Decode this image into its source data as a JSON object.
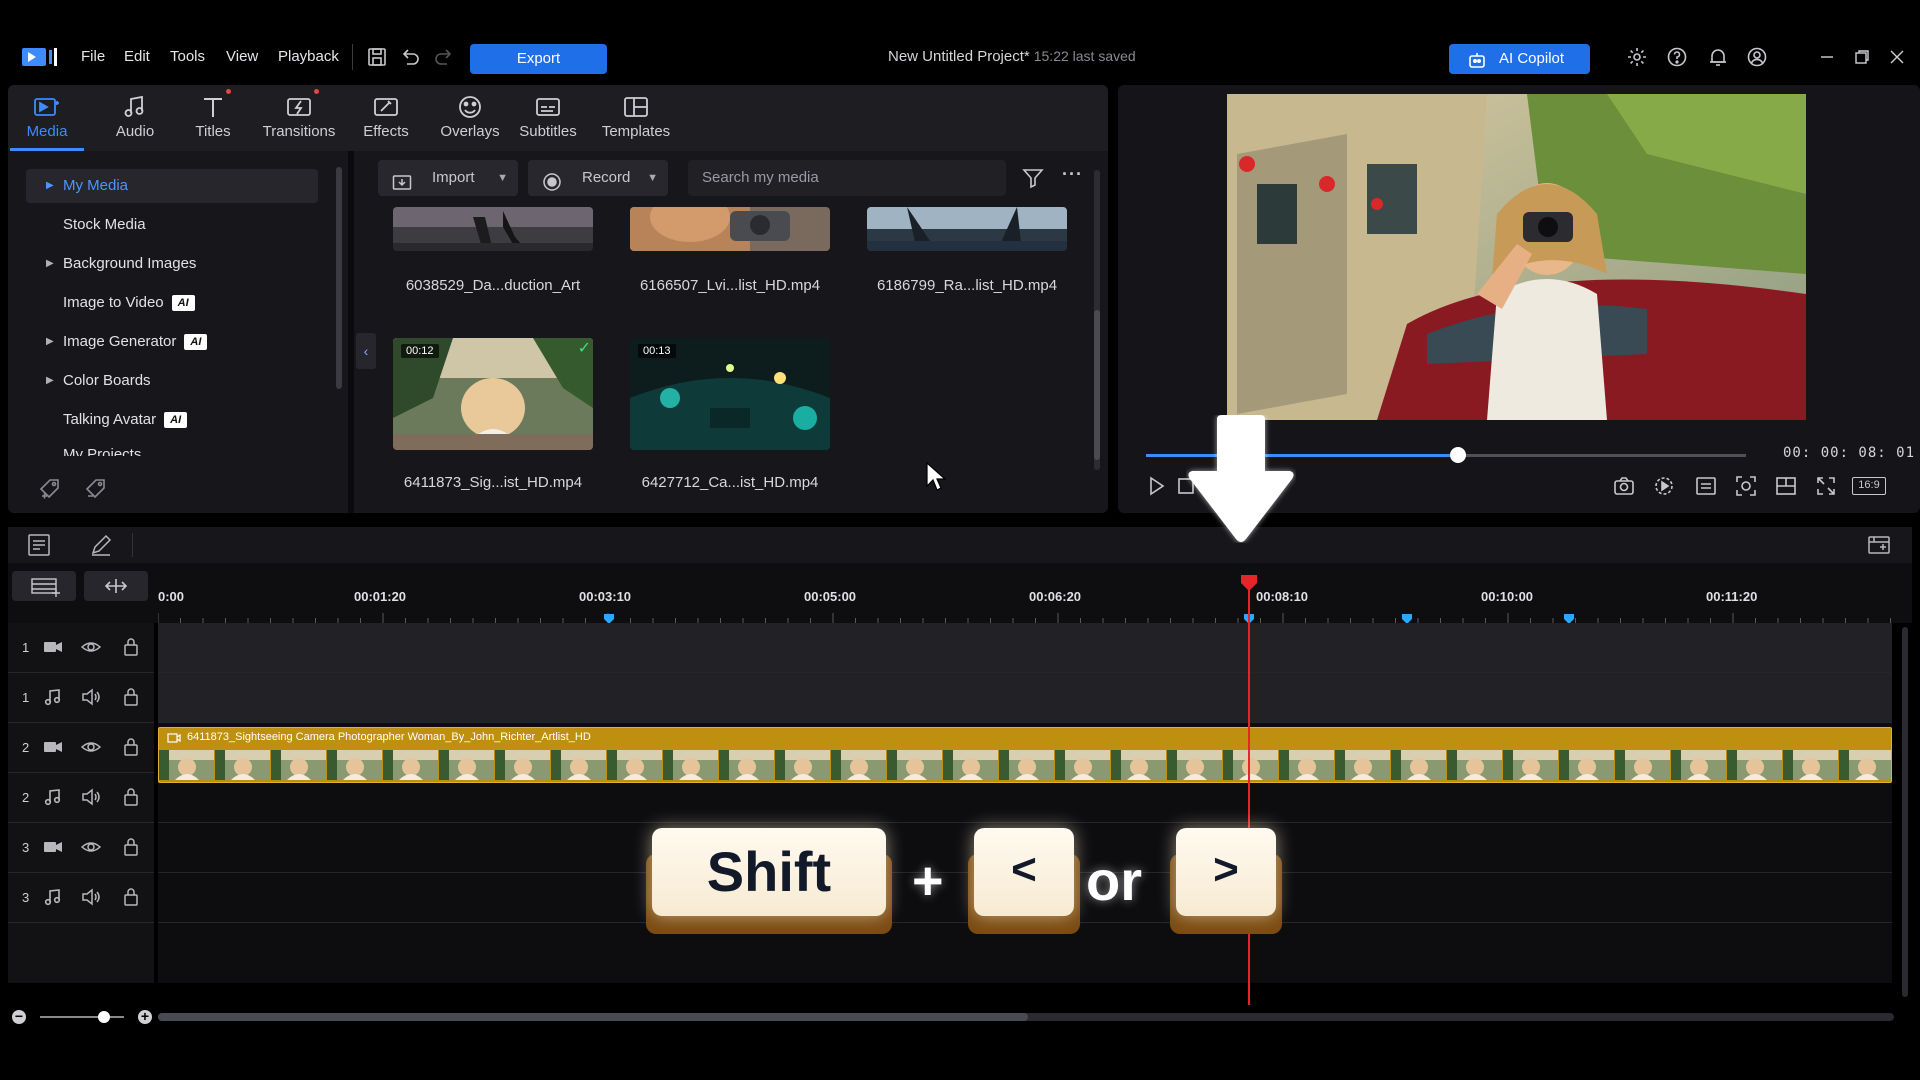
{
  "menu": {
    "items": [
      "File",
      "Edit",
      "Tools",
      "View",
      "Playback"
    ],
    "export_label": "Export",
    "project_title": "New Untitled Project*",
    "last_saved": "15:22 last saved",
    "ai_copilot_label": "AI Copilot"
  },
  "tabs": [
    {
      "label": "Media",
      "icon": "media-icon",
      "active": true
    },
    {
      "label": "Audio",
      "icon": "music-note-icon"
    },
    {
      "label": "Titles",
      "icon": "titles-icon",
      "dot": true
    },
    {
      "label": "Transitions",
      "icon": "transitions-icon",
      "dot": true
    },
    {
      "label": "Effects",
      "icon": "effects-icon"
    },
    {
      "label": "Overlays",
      "icon": "overlays-icon"
    },
    {
      "label": "Subtitles",
      "icon": "subtitles-icon"
    },
    {
      "label": "Templates",
      "icon": "templates-icon"
    }
  ],
  "sidebar": {
    "items": [
      {
        "label": "My Media",
        "expandable": true,
        "selected": true
      },
      {
        "label": "Stock Media"
      },
      {
        "label": "Background Images",
        "expandable": true
      },
      {
        "label": "Image to Video",
        "ai": true
      },
      {
        "label": "Image Generator",
        "expandable": true,
        "ai": true
      },
      {
        "label": "Color Boards",
        "expandable": true
      },
      {
        "label": "Talking Avatar",
        "ai": true
      },
      {
        "label": "My Projects"
      }
    ],
    "ai_badge": "AI"
  },
  "media_toolbar": {
    "import_label": "Import",
    "record_label": "Record",
    "search_placeholder": "Search my media"
  },
  "media_items": [
    {
      "label": "6038529_Da...duction_Art"
    },
    {
      "label": "6166507_Lvi...list_HD.mp4"
    },
    {
      "label": "6186799_Ra...list_HD.mp4"
    },
    {
      "label": "6411873_Sig...ist_HD.mp4",
      "duration": "00:12",
      "checked": true
    },
    {
      "label": "6427712_Ca...ist_HD.mp4",
      "duration": "00:13"
    }
  ],
  "preview": {
    "timecode": "00: 00: 08: 01",
    "progress": 0.52,
    "aspect_ratio": "16:9"
  },
  "timeline": {
    "ruler_labels": [
      "0:00",
      "00:01:20",
      "00:03:10",
      "00:05:00",
      "00:06:20",
      "00:08:10",
      "00:10:00",
      "00:11:20"
    ],
    "tracks": [
      {
        "number": "1",
        "type": "video"
      },
      {
        "number": "1",
        "type": "audio"
      },
      {
        "number": "2",
        "type": "video"
      },
      {
        "number": "2",
        "type": "audio"
      },
      {
        "number": "3",
        "type": "video"
      },
      {
        "number": "3",
        "type": "audio"
      }
    ],
    "clip_title": "6411873_Sightseeing Camera Photographer Woman_By_John_Richter_Artlist_HD"
  },
  "shortcut_overlay": {
    "key1": "Shift",
    "plus": "+",
    "key2": "<",
    "or": "or",
    "key3": ">"
  },
  "colors": {
    "accent": "#1e6fe8",
    "clip": "#bf8f10",
    "playhead": "#e5252a"
  }
}
